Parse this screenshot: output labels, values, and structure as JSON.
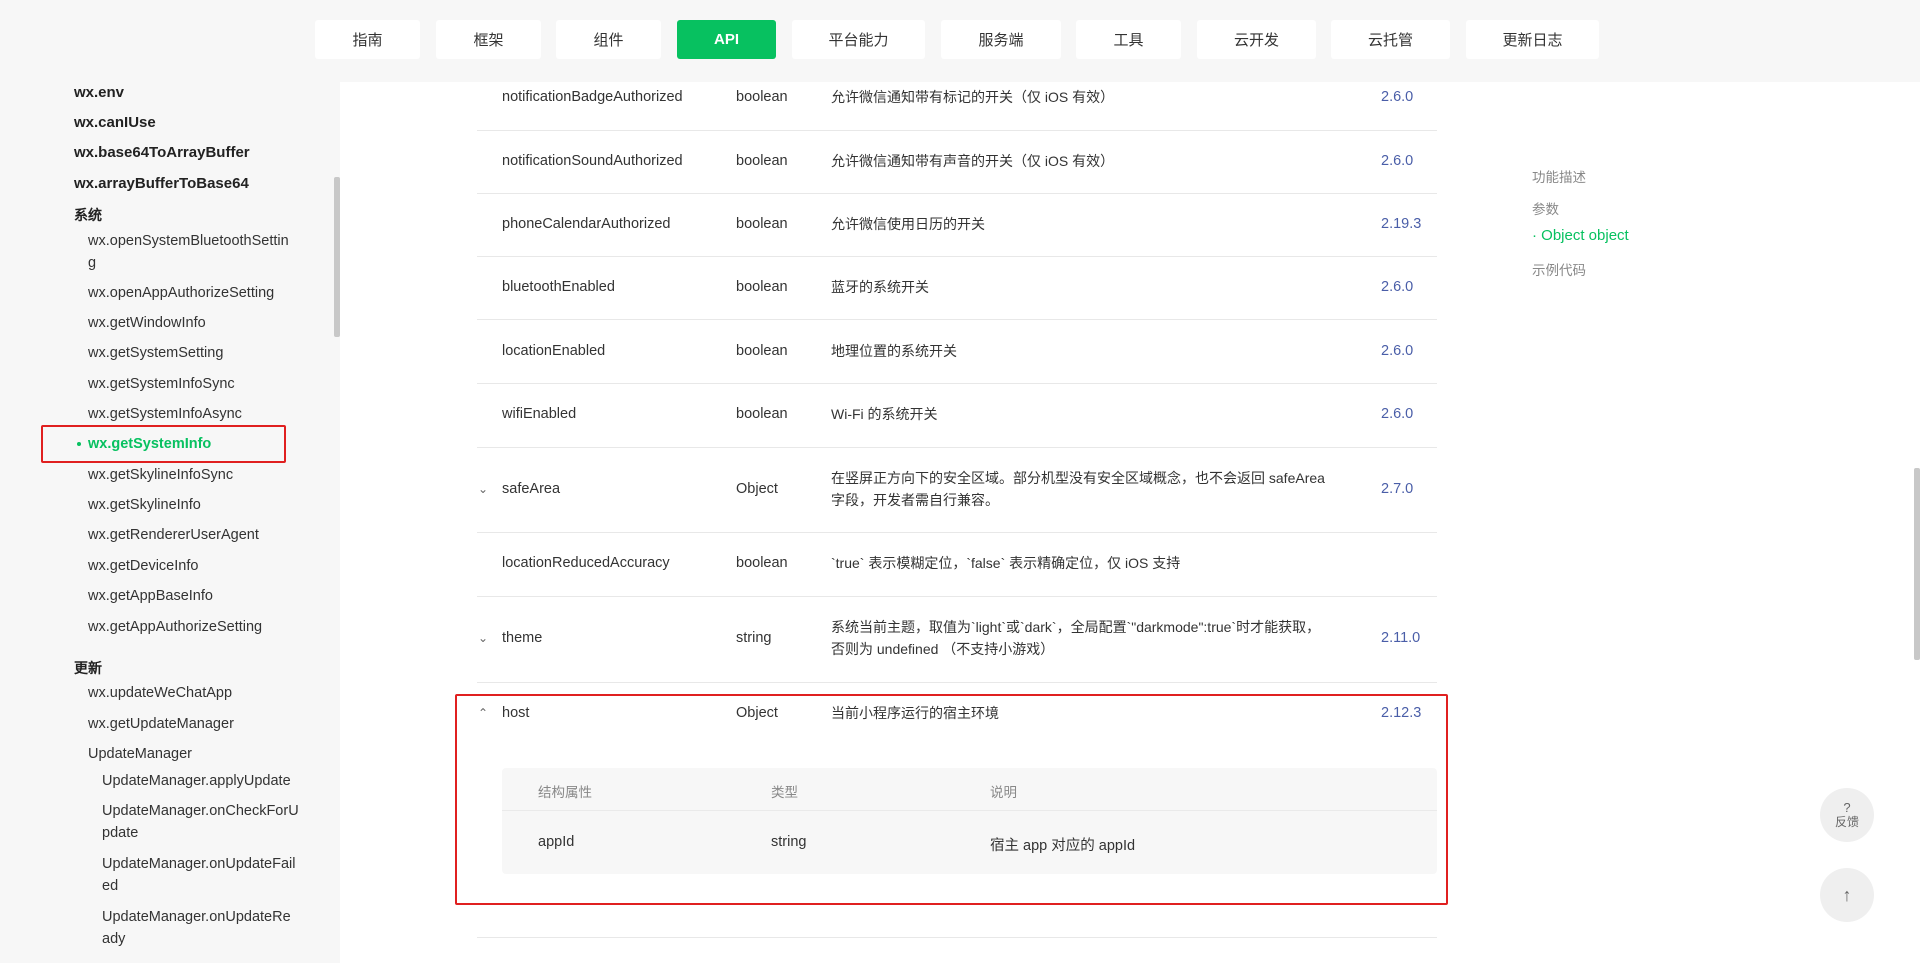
{
  "nav": {
    "tabs": [
      "指南",
      "框架",
      "组件",
      "API",
      "平台能力",
      "服务端",
      "工具",
      "云开发",
      "云托管",
      "更新日志"
    ],
    "active_index": 3
  },
  "sidebar": {
    "top_items": [
      "wx.env",
      "wx.canIUse",
      "wx.base64ToArrayBuffer",
      "wx.arrayBufferToBase64"
    ],
    "cat_system": "系统",
    "system_items": {
      "openSystemBluetoothSetting_1": "wx.openSystemBluetoothSettin",
      "openSystemBluetoothSetting_2": "g",
      "openAppAuthorizeSetting": "wx.openAppAuthorizeSetting",
      "getWindowInfo": "wx.getWindowInfo",
      "getSystemSetting": "wx.getSystemSetting",
      "getSystemInfoSync": "wx.getSystemInfoSync",
      "getSystemInfoAsync": "wx.getSystemInfoAsync",
      "getSystemInfo": "wx.getSystemInfo",
      "getSkylineInfoSync": "wx.getSkylineInfoSync",
      "getSkylineInfo": "wx.getSkylineInfo",
      "getRendererUserAgent": "wx.getRendererUserAgent",
      "getDeviceInfo": "wx.getDeviceInfo",
      "getAppBaseInfo": "wx.getAppBaseInfo",
      "getAppAuthorizeSetting": "wx.getAppAuthorizeSetting"
    },
    "cat_update": "更新",
    "update_items": {
      "updateWeChatApp": "wx.updateWeChatApp",
      "getUpdateManager": "wx.getUpdateManager",
      "UpdateManager": "UpdateManager",
      "applyUpdate": "UpdateManager.applyUpdate",
      "onCheckForUpdate_1": "UpdateManager.onCheckForU",
      "onCheckForUpdate_2": "pdate",
      "onUpdateFailed_1": "UpdateManager.onUpdateFail",
      "onUpdateFailed_2": "ed",
      "onUpdateReady_1": "UpdateManager.onUpdateRe",
      "onUpdateReady_2": "ady"
    }
  },
  "table": {
    "rows": [
      {
        "name": "notificationBadgeAuthorized",
        "type": "boolean",
        "desc": "允许微信通知带有标记的开关（仅 iOS 有效）",
        "ver": "2.6.0"
      },
      {
        "name": "notificationSoundAuthorized",
        "type": "boolean",
        "desc": "允许微信通知带有声音的开关（仅 iOS 有效）",
        "ver": "2.6.0"
      },
      {
        "name": "phoneCalendarAuthorized",
        "type": "boolean",
        "desc": "允许微信使用日历的开关",
        "ver": "2.19.3"
      },
      {
        "name": "bluetoothEnabled",
        "type": "boolean",
        "desc": "蓝牙的系统开关",
        "ver": "2.6.0"
      },
      {
        "name": "locationEnabled",
        "type": "boolean",
        "desc": "地理位置的系统开关",
        "ver": "2.6.0"
      },
      {
        "name": "wifiEnabled",
        "type": "boolean",
        "desc": "Wi-Fi 的系统开关",
        "ver": "2.6.0"
      },
      {
        "name": "safeArea",
        "type": "Object",
        "desc_1": "在竖屏正方向下的安全区域。部分机型没有安全区域概念，也不会返回 safeArea",
        "desc_2": "字段，开发者需自行兼容。",
        "ver": "2.7.0"
      },
      {
        "name": "locationReducedAccuracy",
        "type": "boolean",
        "desc": "`true` 表示模糊定位，`false` 表示精确定位，仅 iOS 支持",
        "ver": ""
      },
      {
        "name": "theme",
        "type": "string",
        "desc_1": "系统当前主题，取值为`light`或`dark`，全局配置`\"darkmode\":true`时才能获取，",
        "desc_2": "否则为 undefined （不支持小游戏）",
        "ver": "2.11.0"
      },
      {
        "name": "host",
        "type": "Object",
        "desc": "当前小程序运行的宿主环境",
        "ver": "2.12.3"
      }
    ],
    "sub": {
      "headers": [
        "结构属性",
        "类型",
        "说明"
      ],
      "row": {
        "name": "appId",
        "type": "string",
        "desc": "宿主 app 对应的 appId"
      }
    }
  },
  "toc": {
    "items": [
      "功能描述",
      "参数",
      "· Object object",
      "示例代码"
    ],
    "active_index": 2
  },
  "float": {
    "feedback_q": "?",
    "feedback_label": "反馈",
    "top_arrow": "↑"
  },
  "colors": {
    "accent": "#07c160",
    "highlight": "#e02020",
    "version": "#4a5ea8"
  }
}
